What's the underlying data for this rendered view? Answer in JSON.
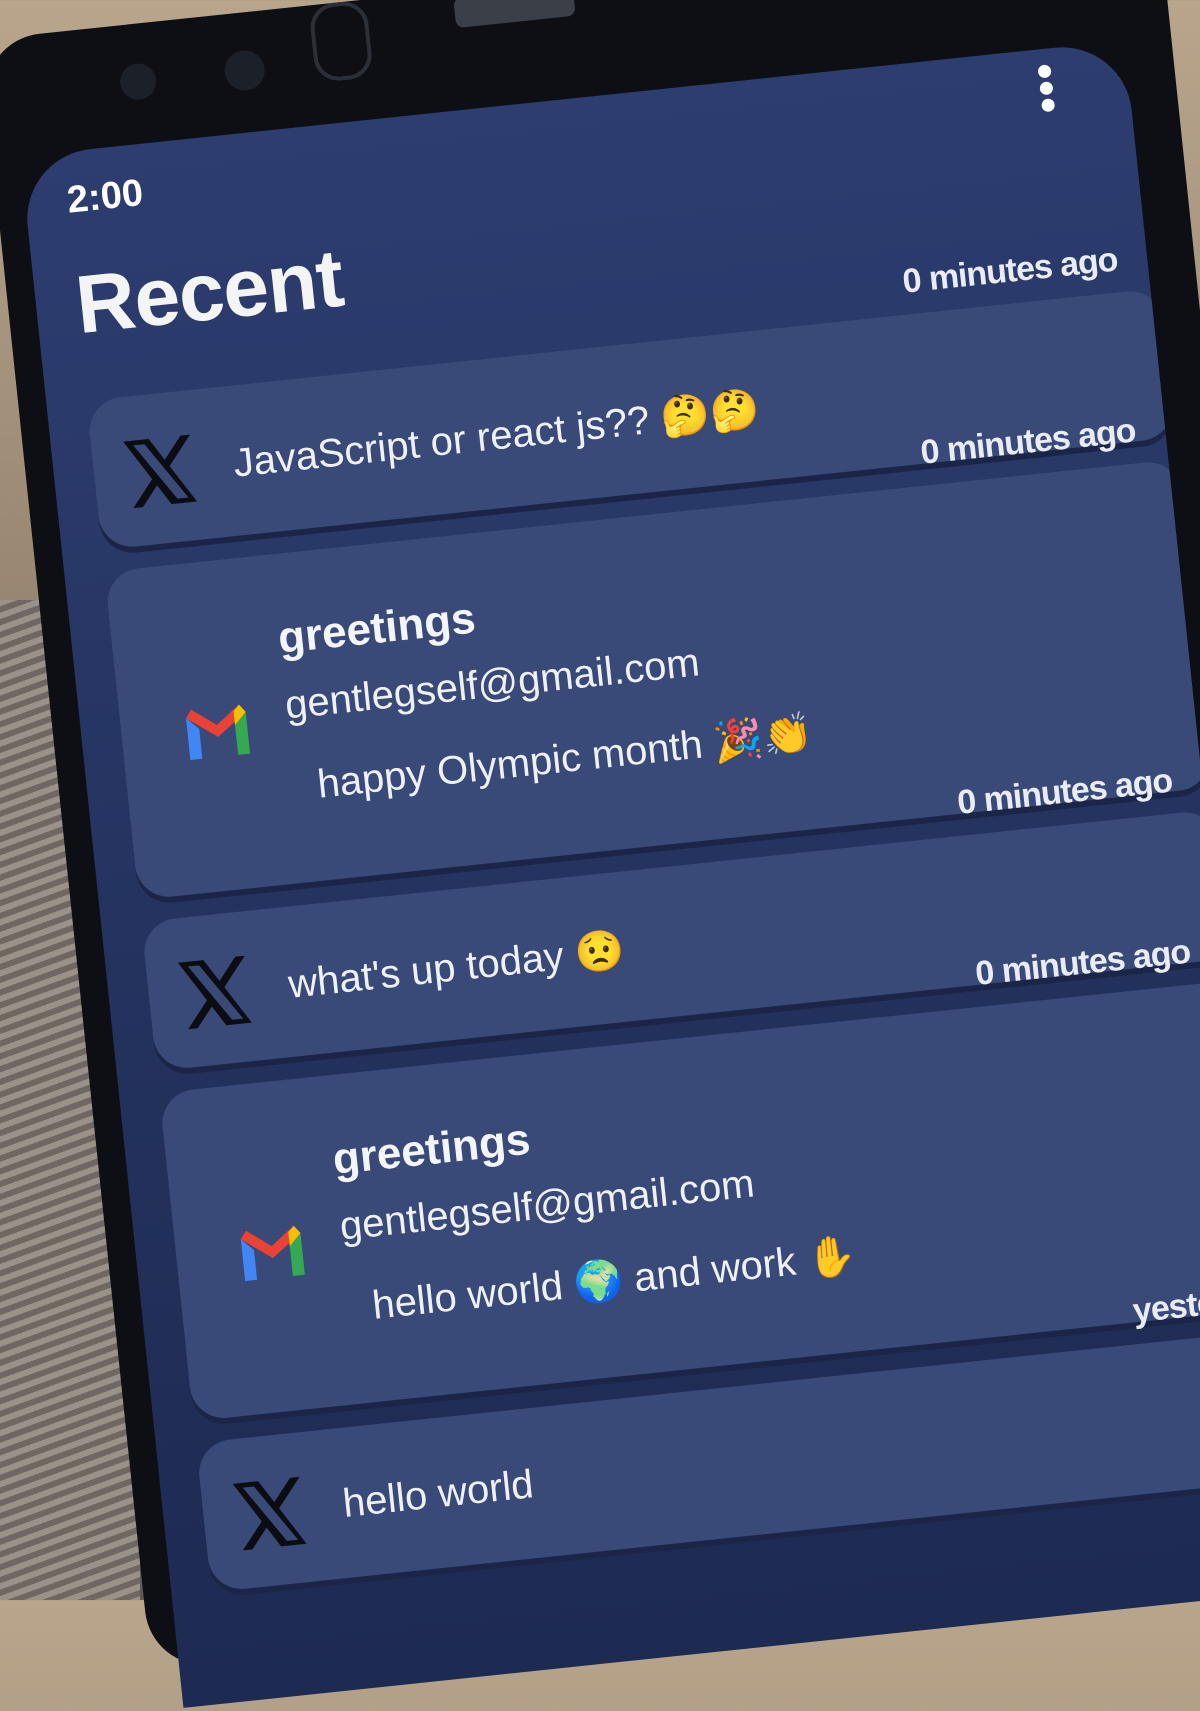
{
  "status_bar": {
    "time": "2:00",
    "signal": "◢▮"
  },
  "header": {
    "title": "Recent"
  },
  "notifications": [
    {
      "app": "X",
      "time": "0 minutes ago",
      "text": "JavaScript or react js?? 🤔🤔"
    },
    {
      "app": "Gmail",
      "time": "0 minutes ago",
      "subject": "greetings",
      "from": "gentlegself@gmail.com",
      "body": "happy Olympic month 🎉👏"
    },
    {
      "app": "X",
      "time": "0 minutes ago",
      "text": "what's up today 😟"
    },
    {
      "app": "Gmail",
      "time": "0 minutes ago",
      "subject": "greetings",
      "from": "gentlegself@gmail.com",
      "body": "hello world 🌍 and work ✋"
    },
    {
      "app": "X",
      "time": "yester",
      "text": "hello world"
    }
  ],
  "colors": {
    "screen_bg": "#26366a",
    "card_bg": "#3a4a78",
    "text": "#eef1f7"
  }
}
